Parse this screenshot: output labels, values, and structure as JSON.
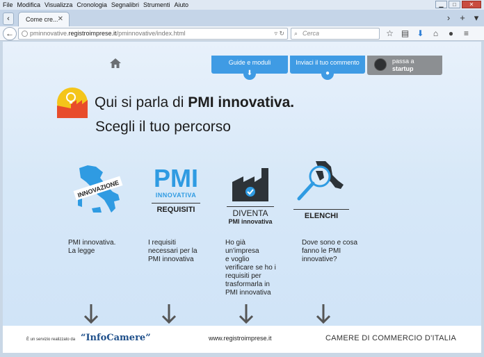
{
  "menu": [
    "File",
    "Modifica",
    "Visualizza",
    "Cronologia",
    "Segnalibri",
    "Strumenti",
    "Aiuto"
  ],
  "tab": {
    "title": "Come cre..."
  },
  "url": {
    "prefix": "pminnovative.",
    "host": "registroimprese.it",
    "path": "/pminnovative/index.html"
  },
  "search": {
    "placeholder": "Cerca"
  },
  "topnav": {
    "guide": "Guide e moduli",
    "comment": "Inviaci il tuo commento",
    "startup_line1": "passa a",
    "startup_line2": "startup"
  },
  "headline": {
    "lead": "Qui si parla di ",
    "bold": "PMI innovativa.",
    "sub": "Scegli il tuo percorso"
  },
  "features": [
    {
      "badge": "INNOVAZIONE",
      "text": [
        "PMI innovativa.",
        "La legge"
      ]
    },
    {
      "badge1": "PMI",
      "badge2": "INNOVATIVA",
      "badge3": "REQUISITI",
      "text": [
        "I requisiti",
        "necessari per la",
        "PMI innovativa"
      ]
    },
    {
      "badge1": "DIVENTA",
      "badge2": "PMI innovativa",
      "text": [
        "Ho già",
        "un'impresa",
        "e voglio",
        "verificare se ho i",
        "requisiti per",
        "trasformarla in",
        "PMI innovativa"
      ]
    },
    {
      "badge": "ELENCHI",
      "text": [
        "Dove sono e cosa",
        "fanno le PMI",
        "innovative?"
      ]
    }
  ],
  "footer": {
    "small": "È un servizio realizzato da",
    "infocamere": "“InfoCamere”",
    "url": "www.registroimprese.it",
    "camere": "CAMERE DI COMMERCIO D'ITALIA"
  },
  "colors": {
    "accent": "#3f9be4",
    "startup": "#8c8f92",
    "logo_yellow": "#f4c51a",
    "logo_red": "#e84c2b"
  }
}
